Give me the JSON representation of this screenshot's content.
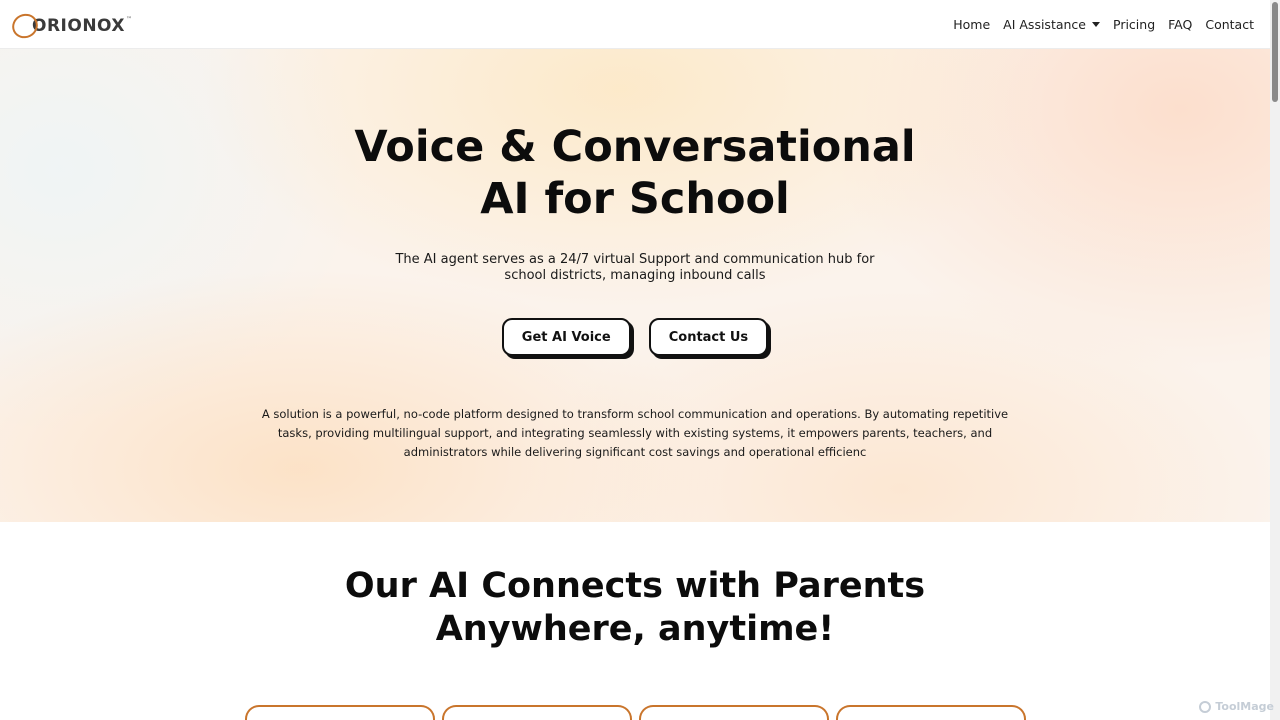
{
  "logo": {
    "text": "ORIONOX",
    "tm": "™",
    "accent": "#c9752c"
  },
  "nav": {
    "home": "Home",
    "ai_assistance": "AI Assistance",
    "pricing": "Pricing",
    "faq": "FAQ",
    "contact": "Contact"
  },
  "hero": {
    "title_line1": "Voice & Conversational",
    "title_line2": "AI for School",
    "subtitle": "The AI agent serves as a 24/7 virtual Support and communication hub for school districts, managing inbound calls",
    "btn_primary": "Get AI Voice",
    "btn_secondary": "Contact Us",
    "description": "A solution is a powerful, no-code platform designed to transform school communication and operations. By automating repetitive tasks, providing multilingual support, and integrating seamlessly with existing systems, it empowers parents, teachers, and administrators while delivering significant cost savings and operational efficienc"
  },
  "section2": {
    "title_line1": "Our AI Connects with Parents",
    "title_line2": "Anywhere, anytime!"
  },
  "watermark": {
    "text": "ToolMage"
  }
}
